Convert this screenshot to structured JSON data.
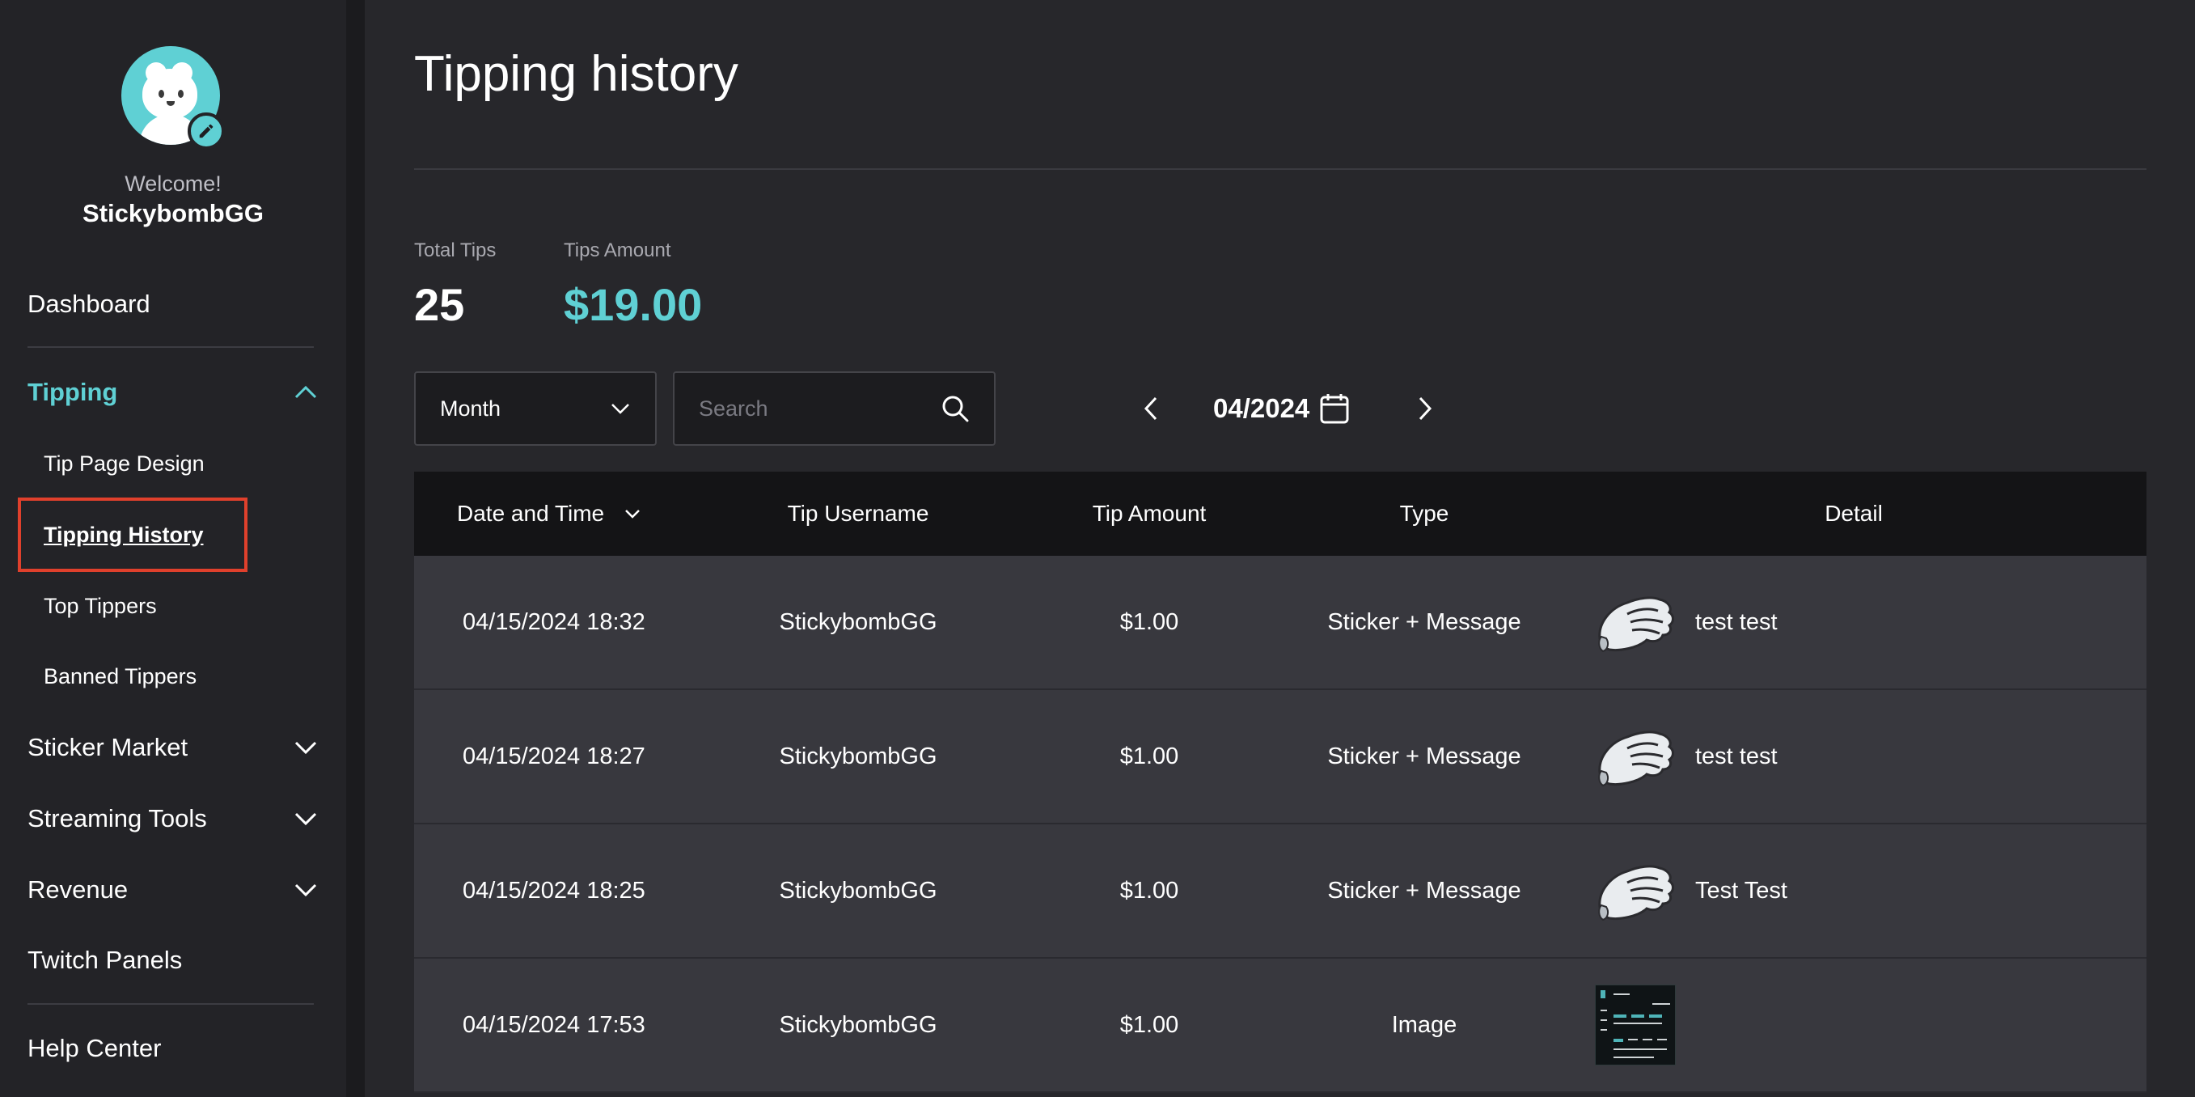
{
  "sidebar": {
    "welcome": "Welcome!",
    "username": "StickybombGG",
    "nav": {
      "dashboard": "Dashboard",
      "tipping": "Tipping",
      "tipping_sub": [
        "Tip Page Design",
        "Tipping History",
        "Top Tippers",
        "Banned Tippers"
      ],
      "sticker_market": "Sticker Market",
      "streaming_tools": "Streaming Tools",
      "revenue": "Revenue",
      "twitch_panels": "Twitch Panels",
      "help_center": "Help Center"
    },
    "current": "Tipping History"
  },
  "main": {
    "title": "Tipping history",
    "stats": {
      "total_tips_label": "Total Tips",
      "total_tips_value": "25",
      "tips_amount_label": "Tips Amount",
      "tips_amount_value": "$19.00"
    },
    "filter": {
      "period": "Month",
      "search_placeholder": "Search",
      "date": "04/2024"
    },
    "table": {
      "columns": [
        "Date and Time",
        "Tip Username",
        "Tip Amount",
        "Type",
        "Detail"
      ],
      "rows": [
        {
          "datetime": "04/15/2024 18:32",
          "username": "StickybombGG",
          "amount": "$1.00",
          "type": "Sticker + Message",
          "detail": "test test"
        },
        {
          "datetime": "04/15/2024 18:27",
          "username": "StickybombGG",
          "amount": "$1.00",
          "type": "Sticker + Message",
          "detail": "test test"
        },
        {
          "datetime": "04/15/2024 18:25",
          "username": "StickybombGG",
          "amount": "$1.00",
          "type": "Sticker + Message",
          "detail": "Test Test"
        },
        {
          "datetime": "04/15/2024 17:53",
          "username": "StickybombGG",
          "amount": "$1.00",
          "type": "Image",
          "detail": ""
        }
      ]
    }
  },
  "colors": {
    "accent": "#5fd0d4",
    "sidebar_bg": "#232327",
    "page_bg": "#27272b",
    "table_header_bg": "#141416",
    "row_bg": "#38383e",
    "highlight": "#e0402c"
  },
  "icons": [
    "edit-icon",
    "chevron-up-icon",
    "chevron-down-icon",
    "search-icon",
    "chevron-left-icon",
    "chevron-right-icon",
    "calendar-icon",
    "glove-sticker-icon"
  ]
}
